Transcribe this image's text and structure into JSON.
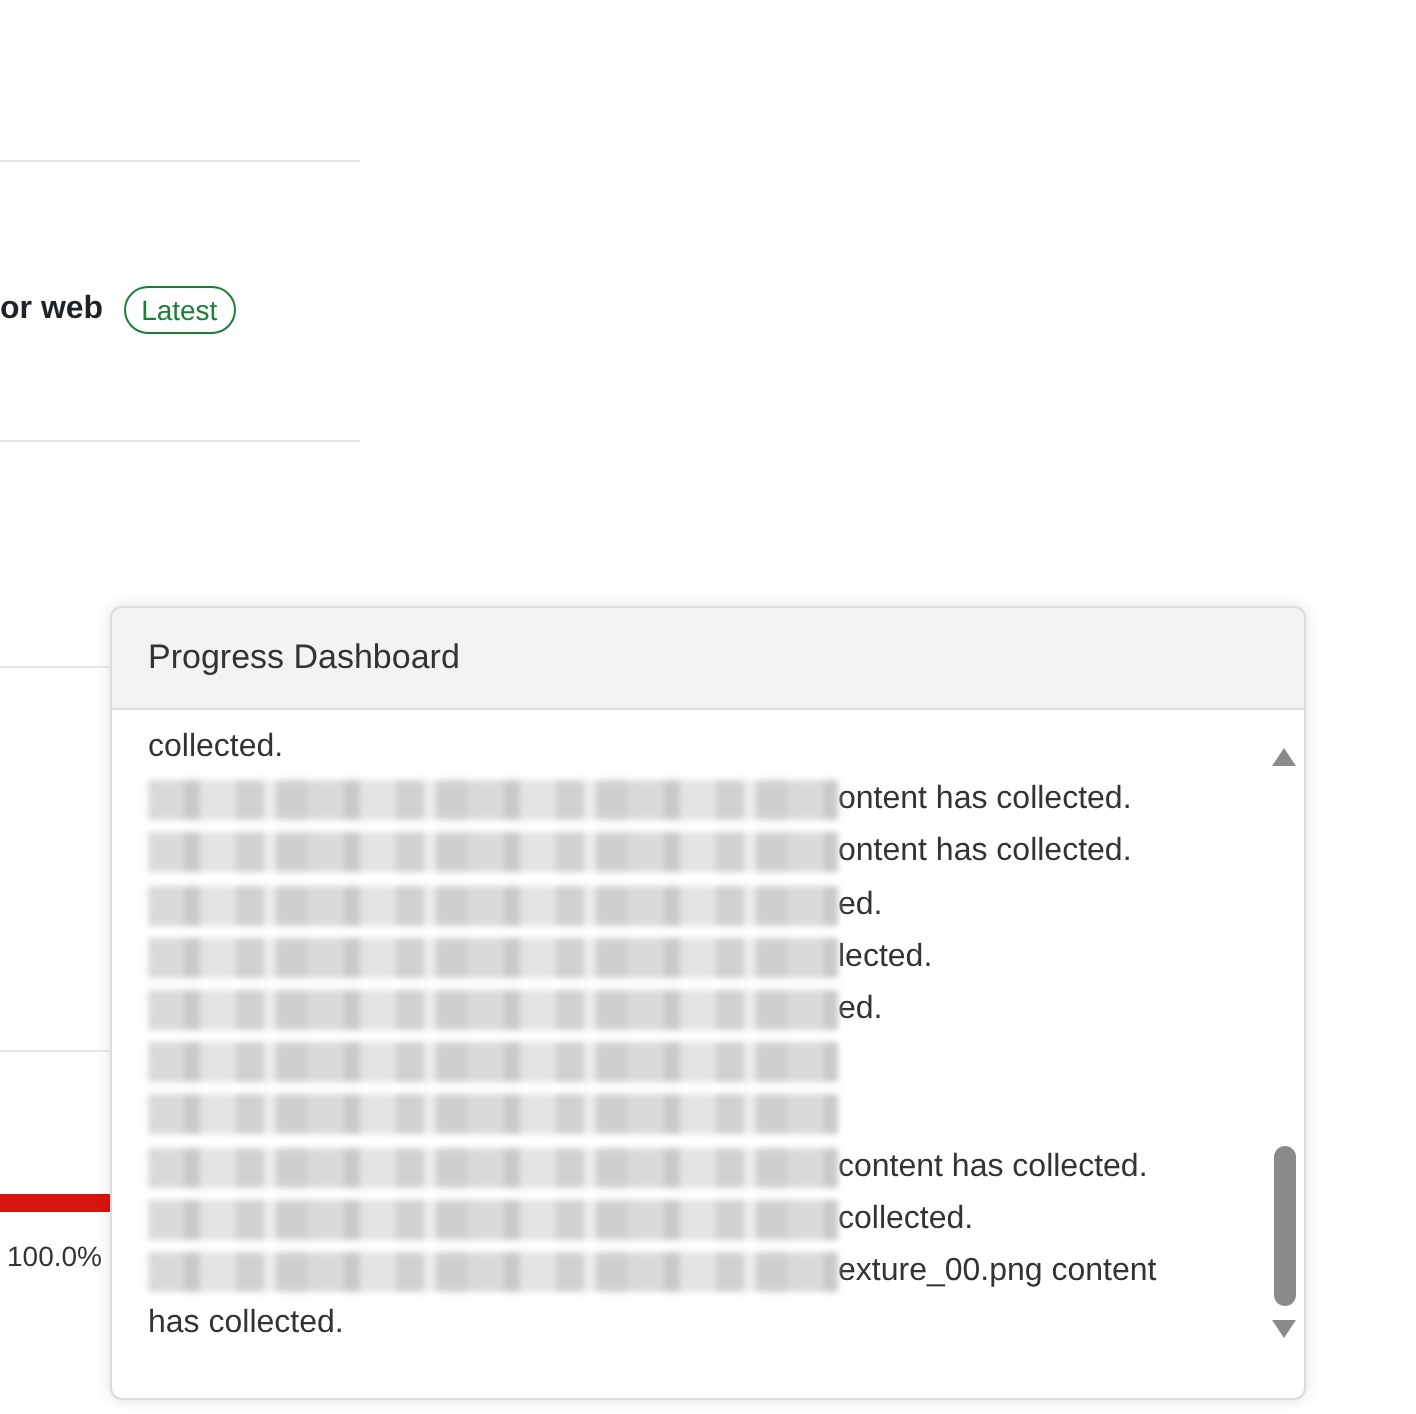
{
  "background_page": {
    "release_title": "or web",
    "release_badge": "Latest",
    "progress": {
      "level": 1,
      "reading": "100.0%"
    }
  },
  "progress_dashboard": {
    "title": "Progress Dashboard",
    "log_lines": [
      {
        "kind": "plain",
        "text": "collected."
      },
      {
        "kind": "redacted",
        "text": "ontent has collected."
      },
      {
        "kind": "redacted",
        "text": "ontent has collected."
      },
      {
        "kind": "redacted",
        "text": "ed."
      },
      {
        "kind": "redacted",
        "text": "lected."
      },
      {
        "kind": "redacted",
        "text": "ed."
      },
      {
        "kind": "redacted"
      },
      {
        "kind": "redacted"
      },
      {
        "kind": "redacted",
        "text": "content has collected."
      },
      {
        "kind": "redacted",
        "text": "collected."
      },
      {
        "kind": "redacted",
        "text": "exture_00.png content"
      },
      {
        "kind": "plain",
        "text": "has collected."
      }
    ]
  }
}
